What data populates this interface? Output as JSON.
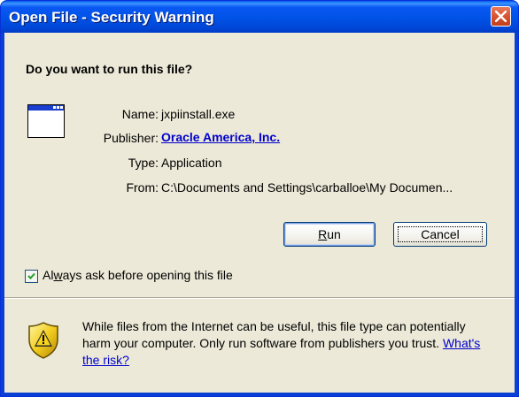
{
  "window": {
    "title": "Open File - Security Warning",
    "close_label": "close",
    "titlebar_color": "#0054e3",
    "client_color": "#ece9d8"
  },
  "prompt": {
    "heading": "Do you want to run this file?"
  },
  "file_info": {
    "icon": "application-window-icon",
    "rows": [
      {
        "label": "Name:",
        "value": "jxpiinstall.exe"
      },
      {
        "label": "Publisher:",
        "value": "Oracle America, Inc."
      },
      {
        "label": "Type:",
        "value": "Application"
      },
      {
        "label": "From:",
        "value": "C:\\Documents and Settings\\carballoe\\My Documen..."
      }
    ]
  },
  "buttons": {
    "run_label_prefix": "",
    "run_label_mnemonic": "R",
    "run_label_suffix": "un",
    "cancel_label": "Cancel"
  },
  "options": {
    "always_ask_prefix": "Al",
    "always_ask_mnemonic": "w",
    "always_ask_suffix": "ays ask before opening this file",
    "always_ask_checked": true
  },
  "warning": {
    "icon": "shield-warning-icon",
    "text": "While files from the Internet can be useful, this file type can potentially harm your computer. Only run software from publishers you trust. ",
    "link_text": "What's the risk?",
    "link_color": "#0000cc"
  }
}
